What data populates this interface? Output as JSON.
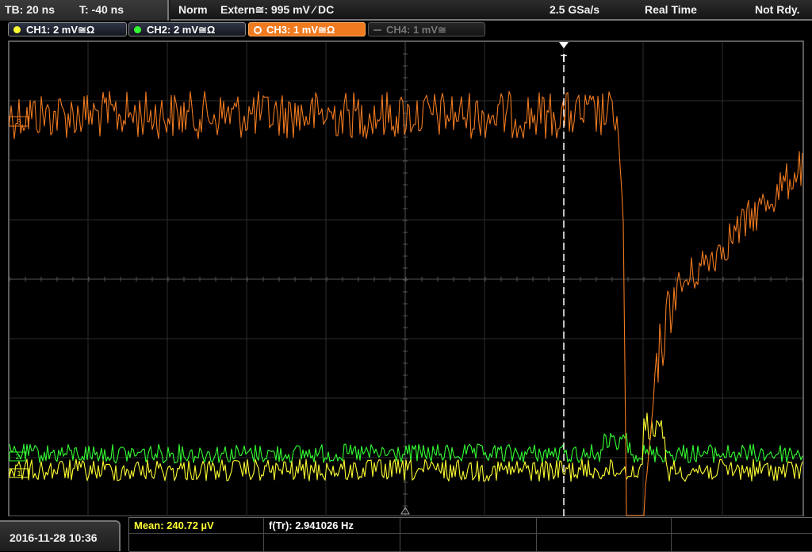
{
  "header": {
    "timebase": "TB: 20 ns",
    "trigger_time": "T: -40 ns",
    "trigger_mode": "Norm",
    "trigger_source": "Extern≅: 995 mV ⁄ DC",
    "sample_rate": "2.5 GSa/s",
    "acquisition_mode": "Real Time",
    "status": "Not Rdy."
  },
  "channels": [
    {
      "label": "CH1: 2 mV≅Ω",
      "color": "#ffff33",
      "active": false,
      "enabled": true
    },
    {
      "label": "CH2: 2 mV≅Ω",
      "color": "#33ff33",
      "active": false,
      "enabled": true
    },
    {
      "label": "CH3: 1 mV≅Ω",
      "color": "#f07a20",
      "active": true,
      "enabled": true
    },
    {
      "label": "CH4: 1 mV≅",
      "color": "#666666",
      "active": false,
      "enabled": false
    }
  ],
  "markers": {
    "trigger_marker": "T",
    "ch3_offset_label": "3",
    "ch2_offset_label": "2",
    "ch1_offset_label": "1"
  },
  "measurements": {
    "mean": "Mean: 240.72 µV",
    "mean_color": "#ffff33",
    "frequency": "f(Tr): 2.941026 Hz"
  },
  "datetime": "2016-11-28 10:36"
}
